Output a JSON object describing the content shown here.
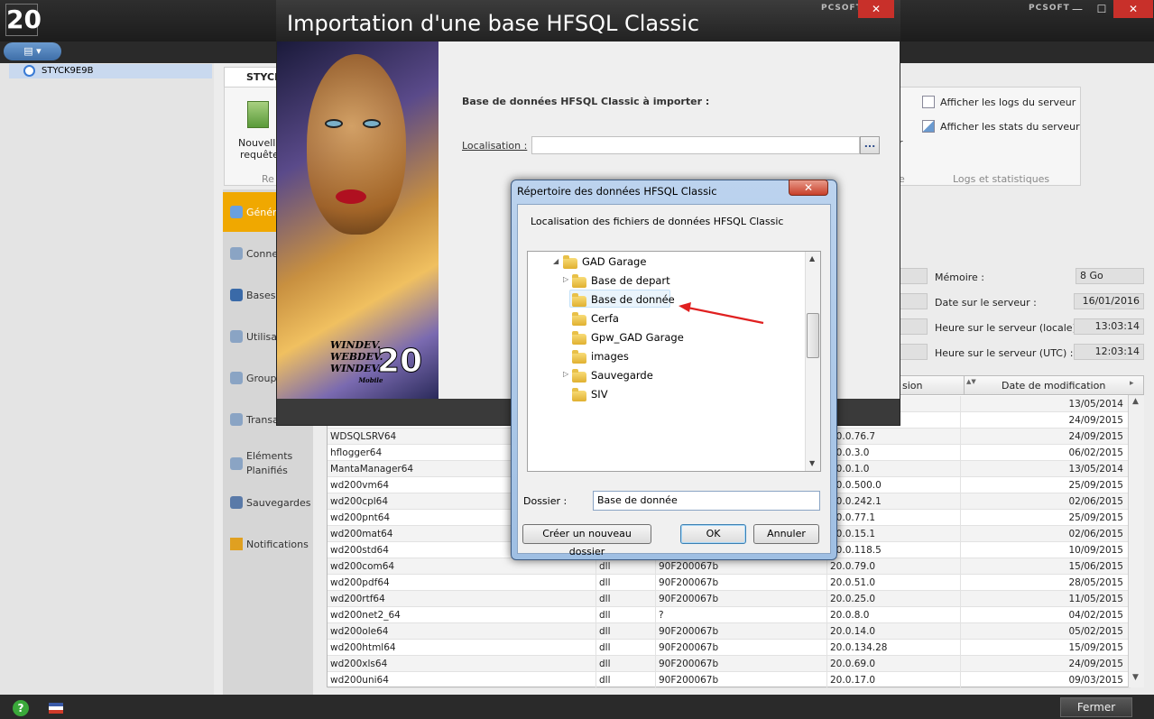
{
  "app": {
    "logo": "20",
    "brand": "PCSOFT",
    "win_min": "—",
    "win_max": "☐",
    "win_close": "✕",
    "menu_pill": "▤ ▾",
    "server": "STYCK9E9B",
    "fermer": "Fermer",
    "status_help": "?"
  },
  "ribbon": {
    "tab": "STYCK",
    "new_query": "Nouvelle",
    "new_query2": "requête",
    "group_left": "Re",
    "logs": "Afficher les logs du serveur",
    "stats": "Afficher les stats du serveur",
    "group_logs": "Logs et statistiques",
    "partial_r": "r",
    "partial_e": "e"
  },
  "nav": [
    {
      "label": "Généra"
    },
    {
      "label": "Conne"
    },
    {
      "label": "Bases"
    },
    {
      "label": "Utilisa"
    },
    {
      "label": "Groupe"
    },
    {
      "label": "Transa"
    },
    {
      "label": "Eléments"
    },
    {
      "label": "Sauvegardes"
    },
    {
      "label": "Notifications"
    }
  ],
  "nav_extra": "Planifiés",
  "info": {
    "memoire_label": "Mémoire :",
    "memoire": "8 Go",
    "date_label": "Date sur le serveur :",
    "date": "16/01/2016",
    "heure_locale_label": "Heure sur le serveur (locale) :",
    "heure_locale": "13:03:14",
    "heure_utc_label": "Heure sur le serveur (UTC) :",
    "heure_utc": "12:03:14"
  },
  "grid": {
    "col_version": "sion",
    "col_date": "Date de modification",
    "rows": [
      [
        "",
        "",
        "",
        "",
        "13/05/2014"
      ],
      [
        "",
        "",
        "",
        "",
        "24/09/2015"
      ],
      [
        "WDSQLSRV64",
        "",
        "",
        "20.0.76.7",
        "24/09/2015"
      ],
      [
        "hflogger64",
        "",
        "",
        "20.0.3.0",
        "06/02/2015"
      ],
      [
        "MantaManager64",
        "",
        "",
        "20.0.1.0",
        "13/05/2014"
      ],
      [
        "wd200vm64",
        "",
        "",
        "20.0.500.0",
        "25/09/2015"
      ],
      [
        "wd200cpl64",
        "",
        "",
        "20.0.242.1",
        "02/06/2015"
      ],
      [
        "wd200pnt64",
        "",
        "",
        "20.0.77.1",
        "25/09/2015"
      ],
      [
        "wd200mat64",
        "",
        "",
        "20.0.15.1",
        "02/06/2015"
      ],
      [
        "wd200std64",
        "",
        "",
        "20.0.118.5",
        "10/09/2015"
      ],
      [
        "wd200com64",
        "dll",
        "90F200067b",
        "20.0.79.0",
        "15/06/2015"
      ],
      [
        "wd200pdf64",
        "dll",
        "90F200067b",
        "20.0.51.0",
        "28/05/2015"
      ],
      [
        "wd200rtf64",
        "dll",
        "90F200067b",
        "20.0.25.0",
        "11/05/2015"
      ],
      [
        "wd200net2_64",
        "dll",
        "?",
        "20.0.8.0",
        "04/02/2015"
      ],
      [
        "wd200ole64",
        "dll",
        "90F200067b",
        "20.0.14.0",
        "05/02/2015"
      ],
      [
        "wd200html64",
        "dll",
        "90F200067b",
        "20.0.134.28",
        "15/09/2015"
      ],
      [
        "wd200xls64",
        "dll",
        "90F200067b",
        "20.0.69.0",
        "24/09/2015"
      ],
      [
        "wd200uni64",
        "dll",
        "90F200067b",
        "20.0.17.0",
        "09/03/2015"
      ]
    ]
  },
  "import": {
    "title": "Importation d'une base HFSQL Classic",
    "brand": "PCSOFT",
    "close": "✕",
    "db_label": "Base de données HFSQL Classic à importer :",
    "loc_label": "Localisation :",
    "browse": "...",
    "splash_l1": "WINDEV.",
    "splash_l2": "WEBDEV.",
    "splash_l3": "WINDEV.",
    "splash_l4": "Mobile",
    "splash_20": "20"
  },
  "folder": {
    "title": "Répertoire des données HFSQL Classic",
    "close": "✕",
    "subtitle": "Localisation des fichiers de données HFSQL Classic",
    "tree": [
      {
        "label": "GAD Garage"
      },
      {
        "label": "Base de depart"
      },
      {
        "label": "Base de donnée"
      },
      {
        "label": "Cerfa"
      },
      {
        "label": "Gpw_GAD Garage"
      },
      {
        "label": "images"
      },
      {
        "label": "Sauvegarde"
      },
      {
        "label": "SIV"
      }
    ],
    "dossier_label": "Dossier :",
    "dossier_value": "Base de donnée",
    "new_folder": "Créer un nouveau dossier",
    "ok": "OK",
    "cancel": "Annuler"
  }
}
